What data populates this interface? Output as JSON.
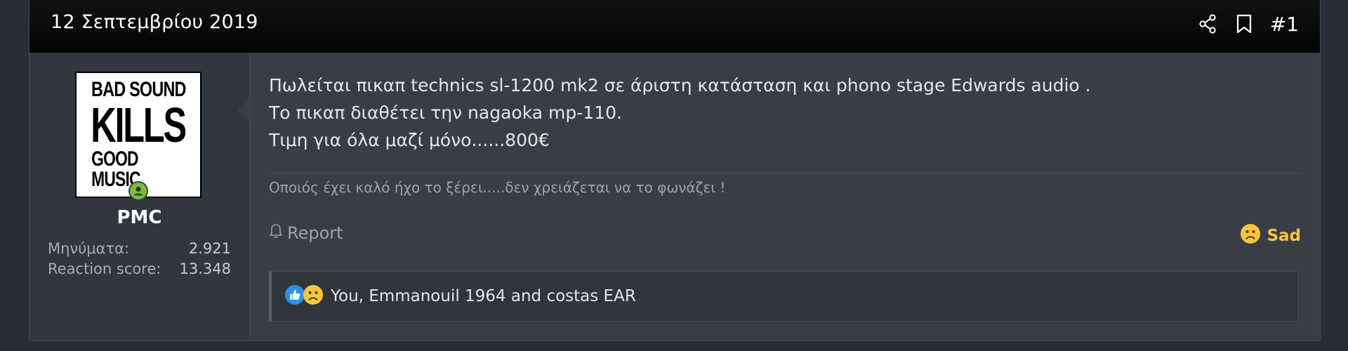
{
  "header": {
    "date": "12 Σεπτεμβρίου 2019",
    "post_number": "#1",
    "share_icon": "share-icon",
    "bookmark_icon": "bookmark-icon"
  },
  "user": {
    "avatar_lines": [
      "BAD SOUND",
      "KILLS",
      "GOOD MUSIC"
    ],
    "username": "PMC",
    "stats": [
      {
        "label": "Μηνύματα:",
        "value": "2.921"
      },
      {
        "label": "Reaction score:",
        "value": "13.348"
      }
    ],
    "online_color": "#7cbf2f"
  },
  "post": {
    "lines": [
      "Πωλείται πικαπ technics sl-1200 mk2 σε άριστη κατάσταση και phono stage Edwards audio .",
      "Το πικαπ διαθέτει την nagaoka mp-110.",
      "Τιμη για όλα μαζί μόνο......800€"
    ],
    "signature": "Οποιός έχει καλό ήχο το ξέρει.....δεν χρειάζεται να το φωνάζει !",
    "report_label": "Report",
    "reaction_label": "Sad",
    "reactions_text": "You, Emmanouil 1964 and costas EAR"
  },
  "colors": {
    "accent_reaction": "#f5c542",
    "like_blue": "#2d8fe6"
  }
}
